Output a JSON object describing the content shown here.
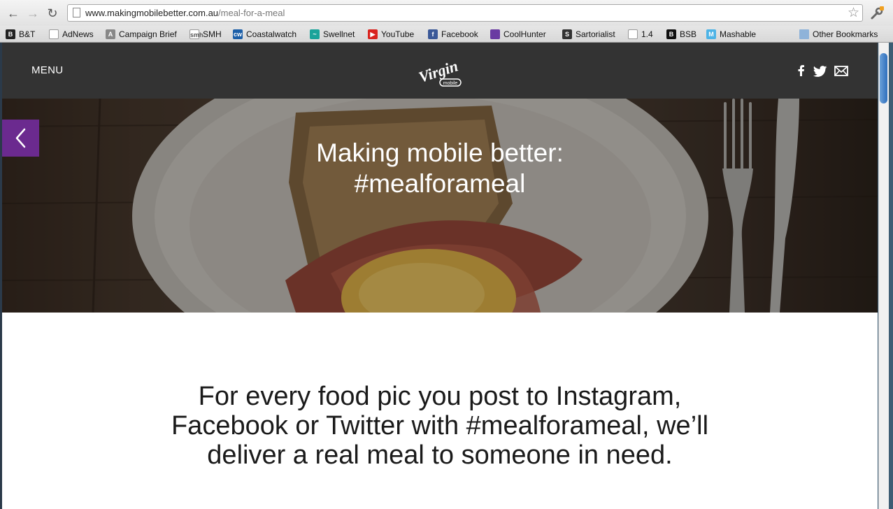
{
  "browser": {
    "url_domain": "www.makingmobilebetter.com.au",
    "url_path": "/meal-for-a-meal",
    "bookmarks": [
      {
        "label": "B&T",
        "icon": "bt-icon",
        "color": "#222222"
      },
      {
        "label": "AdNews",
        "icon": "page-icon",
        "color": "#ffffff"
      },
      {
        "label": "Campaign Brief",
        "icon": "campaign-brief-icon",
        "color": "#888888"
      },
      {
        "label": "SMH",
        "icon": "smh-icon",
        "color": "#ffffff"
      },
      {
        "label": "Coastalwatch",
        "icon": "coastalwatch-icon",
        "color": "#1c5fa8"
      },
      {
        "label": "Swellnet",
        "icon": "swellnet-icon",
        "color": "#1aa39a"
      },
      {
        "label": "YouTube",
        "icon": "youtube-icon",
        "color": "#d9231e"
      },
      {
        "label": "Facebook",
        "icon": "facebook-icon",
        "color": "#3b5998"
      },
      {
        "label": "CoolHunter",
        "icon": "coolhunter-icon",
        "color": "#6a3aa2"
      },
      {
        "label": "Sartorialist",
        "icon": "sartorialist-icon",
        "color": "#333333"
      },
      {
        "label": "1.4",
        "icon": "page-icon",
        "color": "#ffffff"
      },
      {
        "label": "BSB",
        "icon": "bsb-icon",
        "color": "#111111"
      },
      {
        "label": "Mashable",
        "icon": "mashable-icon",
        "color": "#4cb3e6"
      }
    ],
    "other_bookmarks": "Other Bookmarks"
  },
  "site": {
    "menu_label": "MENU",
    "logo_text": "Virgin",
    "logo_sub": "mobile",
    "hero_title_line1": "Making mobile better:",
    "hero_title_line2": "#mealforameal",
    "intro_text": "For every food pic you post to Instagram, Facebook or Twitter with #mealforameal, we’ll deliver a real meal to someone in need.",
    "accent_color": "#6b2a8f",
    "header_color": "#333333"
  }
}
